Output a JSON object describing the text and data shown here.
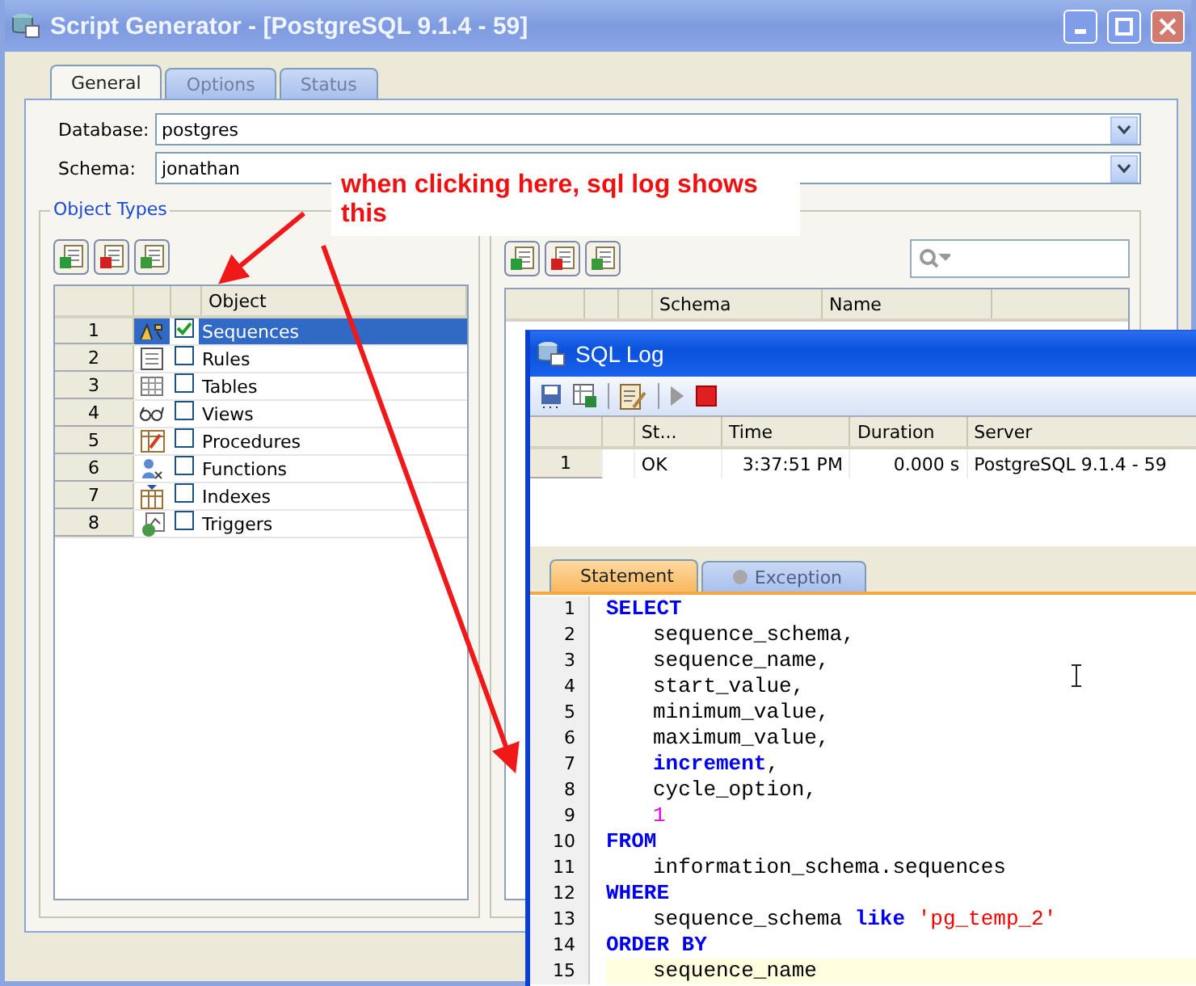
{
  "window": {
    "title": "Script Generator - [PostgreSQL 9.1.4 - 59]"
  },
  "tabs": [
    {
      "label": "General",
      "selected": true,
      "disabled": false
    },
    {
      "label": "Options",
      "selected": false,
      "disabled": true
    },
    {
      "label": "Status",
      "selected": false,
      "disabled": true
    }
  ],
  "database": {
    "label": "Database:",
    "value": "postgres"
  },
  "schema": {
    "label": "Schema:",
    "value": "jonathan"
  },
  "object_types": {
    "title": "Object Types",
    "column": "Object",
    "rows": [
      {
        "number": "1",
        "name": "Sequences",
        "checked": true,
        "selected": true
      },
      {
        "number": "2",
        "name": "Rules",
        "checked": false,
        "selected": false
      },
      {
        "number": "3",
        "name": "Tables",
        "checked": false,
        "selected": false
      },
      {
        "number": "4",
        "name": "Views",
        "checked": false,
        "selected": false
      },
      {
        "number": "5",
        "name": "Procedures",
        "checked": false,
        "selected": false
      },
      {
        "number": "6",
        "name": "Functions",
        "checked": false,
        "selected": false
      },
      {
        "number": "7",
        "name": "Indexes",
        "checked": false,
        "selected": false
      },
      {
        "number": "8",
        "name": "Triggers",
        "checked": false,
        "selected": false
      }
    ]
  },
  "objects": {
    "columns": [
      "Schema",
      "Name"
    ]
  },
  "annotation": {
    "text": "when clicking here, sql log shows this"
  },
  "sql_log": {
    "title": "SQL Log",
    "columns": [
      "St...",
      "Time",
      "Duration",
      "Server"
    ],
    "rows": [
      {
        "number": "1",
        "status": "OK",
        "time": "3:37:51 PM",
        "duration": "0.000 s",
        "server": "PostgreSQL 9.1.4 - 59"
      }
    ],
    "tabs": [
      {
        "label": "Statement",
        "selected": true,
        "disabled": false
      },
      {
        "label": "Exception",
        "selected": false,
        "disabled": true
      }
    ],
    "lines": [
      {
        "number": "1",
        "indented": false,
        "current": false,
        "tokens": [
          {
            "text": "SELECT",
            "kind": "keyword"
          }
        ]
      },
      {
        "number": "2",
        "indented": true,
        "current": false,
        "tokens": [
          {
            "text": "sequence_schema,",
            "kind": "plain"
          }
        ]
      },
      {
        "number": "3",
        "indented": true,
        "current": false,
        "tokens": [
          {
            "text": "sequence_name,",
            "kind": "plain"
          }
        ]
      },
      {
        "number": "4",
        "indented": true,
        "current": false,
        "tokens": [
          {
            "text": "start_value,",
            "kind": "plain"
          }
        ]
      },
      {
        "number": "5",
        "indented": true,
        "current": false,
        "tokens": [
          {
            "text": "minimum_value,",
            "kind": "plain"
          }
        ]
      },
      {
        "number": "6",
        "indented": true,
        "current": false,
        "tokens": [
          {
            "text": "maximum_value,",
            "kind": "plain"
          }
        ]
      },
      {
        "number": "7",
        "indented": true,
        "current": false,
        "tokens": [
          {
            "text": "increment",
            "kind": "keyword"
          },
          {
            "text": ",",
            "kind": "plain"
          }
        ]
      },
      {
        "number": "8",
        "indented": true,
        "current": false,
        "tokens": [
          {
            "text": "cycle_option,",
            "kind": "plain"
          }
        ]
      },
      {
        "number": "9",
        "indented": true,
        "current": false,
        "tokens": [
          {
            "text": "1",
            "kind": "number"
          }
        ]
      },
      {
        "number": "10",
        "indented": false,
        "current": false,
        "tokens": [
          {
            "text": "FROM",
            "kind": "keyword"
          }
        ]
      },
      {
        "number": "11",
        "indented": true,
        "current": false,
        "tokens": [
          {
            "text": "information_schema.sequences",
            "kind": "plain"
          }
        ]
      },
      {
        "number": "12",
        "indented": false,
        "current": false,
        "tokens": [
          {
            "text": "WHERE",
            "kind": "keyword"
          }
        ]
      },
      {
        "number": "13",
        "indented": true,
        "current": false,
        "tokens": [
          {
            "text": "sequence_schema",
            "kind": "plain"
          },
          {
            "text": " like ",
            "kind": "keyword"
          },
          {
            "text": "'pg_temp_2'",
            "kind": "string"
          }
        ]
      },
      {
        "number": "14",
        "indented": false,
        "current": false,
        "tokens": [
          {
            "text": "ORDER BY",
            "kind": "keyword"
          }
        ]
      },
      {
        "number": "15",
        "indented": true,
        "current": true,
        "tokens": [
          {
            "text": "sequence_name",
            "kind": "plain"
          }
        ]
      }
    ]
  }
}
